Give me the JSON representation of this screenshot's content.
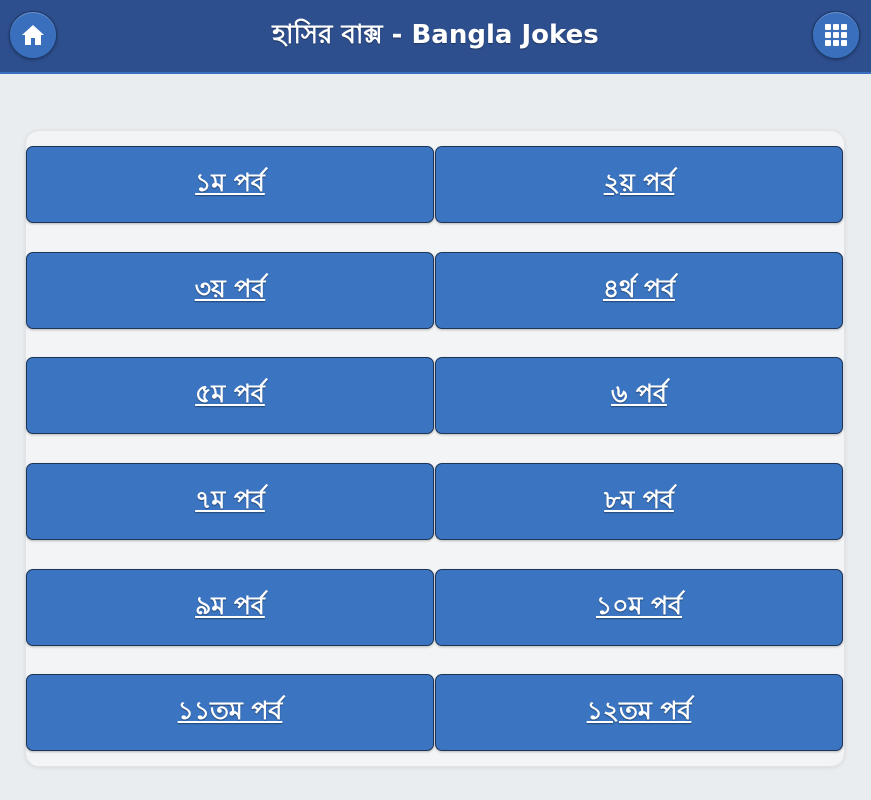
{
  "header": {
    "title": "হাসির বাক্স - Bangla Jokes",
    "home_icon": "home-icon",
    "menu_icon": "grid-menu-icon"
  },
  "episodes": [
    {
      "label": "১ম পর্ব"
    },
    {
      "label": "২য় পর্ব"
    },
    {
      "label": "৩য় পর্ব"
    },
    {
      "label": "৪র্থ পর্ব"
    },
    {
      "label": "৫ম পর্ব"
    },
    {
      "label": "৬ পর্ব"
    },
    {
      "label": "৭ম পর্ব"
    },
    {
      "label": "৮ম পর্ব"
    },
    {
      "label": "৯ম পর্ব"
    },
    {
      "label": "১০ম পর্ব"
    },
    {
      "label": "১১তম পর্ব"
    },
    {
      "label": "১২তম পর্ব"
    }
  ],
  "colors": {
    "header_bg": "#2e4f8e",
    "button_bg": "#3b74c0",
    "page_bg": "#e9edef"
  }
}
